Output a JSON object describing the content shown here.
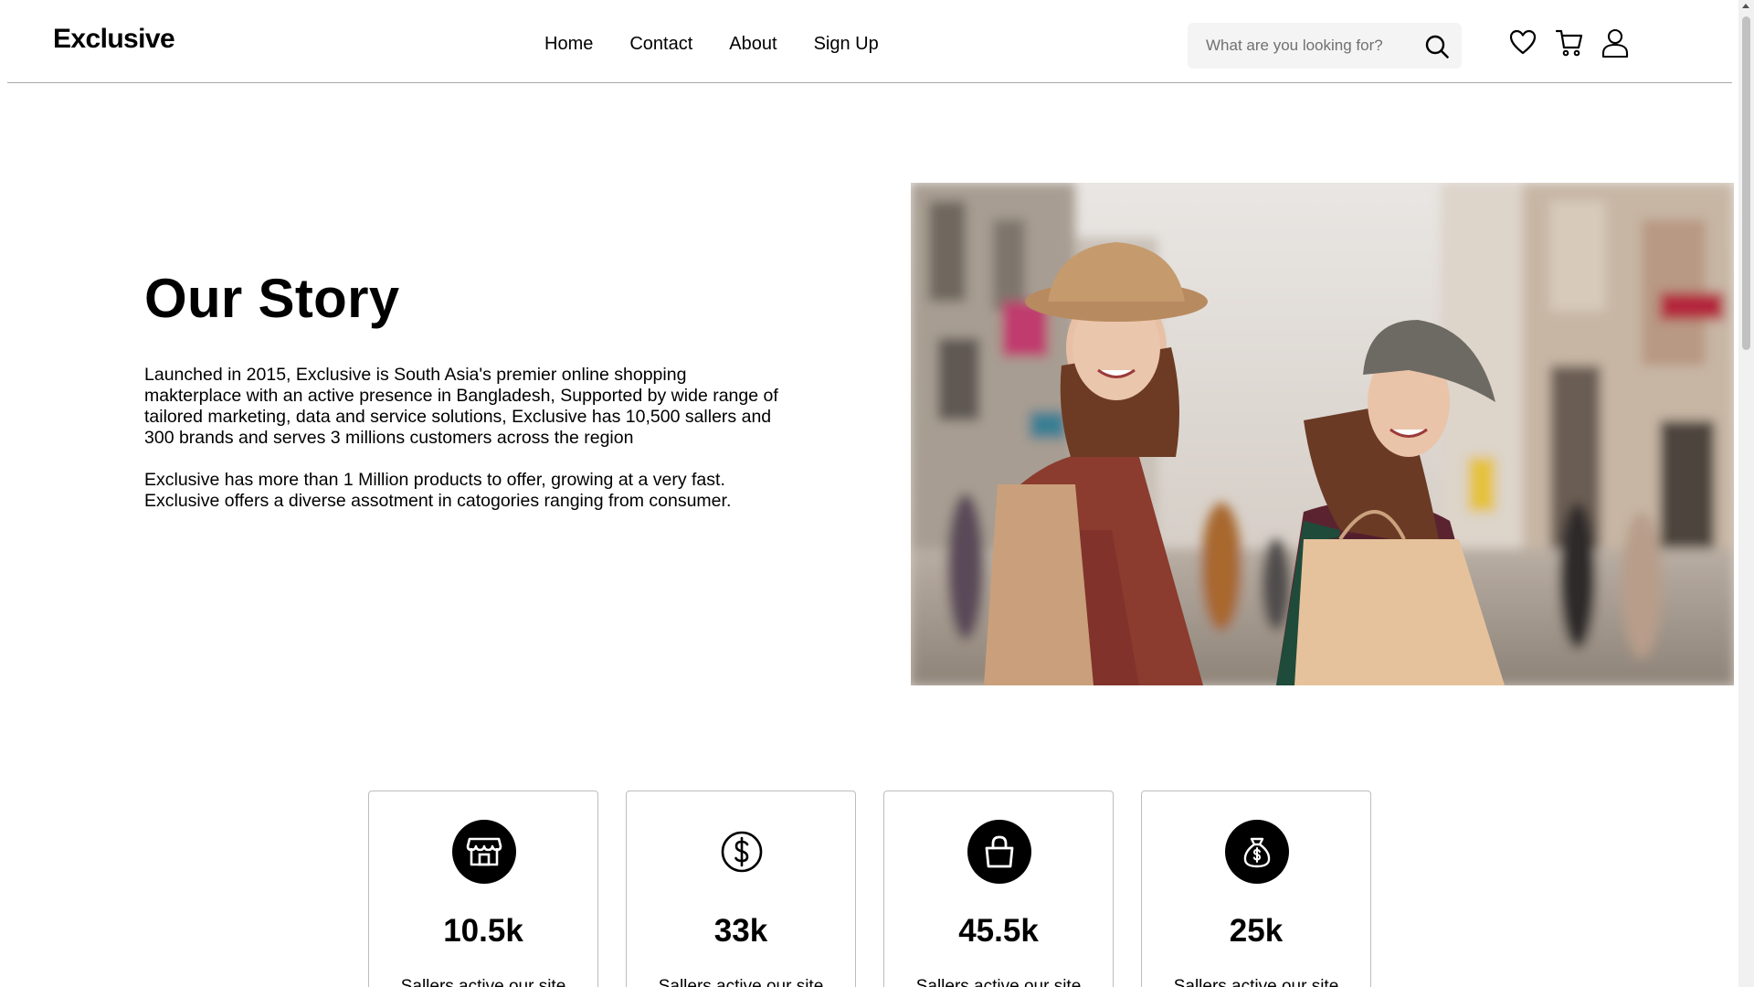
{
  "header": {
    "logo": "Exclusive",
    "nav": [
      {
        "label": "Home"
      },
      {
        "label": "Contact"
      },
      {
        "label": "About"
      },
      {
        "label": "Sign Up"
      }
    ],
    "search": {
      "placeholder": "What are you looking for?",
      "value": "",
      "icon": "search-icon"
    },
    "icons": [
      "heart-icon",
      "cart-icon",
      "user-icon"
    ]
  },
  "story": {
    "title": "Our Story",
    "paragraph1": "Launched in 2015, Exclusive is South Asia's premier online shopping makterplace with an active presence in Bangladesh, Supported by wide range of tailored marketing, data and service solutions, Exclusive has 10,500 sallers and 300 brands and serves 3 millions customers across the region",
    "paragraph2": "Exclusive has more than 1 Million products to offer, growing at a very fast. Exclusive offers a diverse assotment in catogories ranging from consumer.",
    "image": "two-women-shopping-photo"
  },
  "stats": [
    {
      "icon": "shop-icon",
      "value": "10.5k",
      "label": "Sallers active our site"
    },
    {
      "icon": "dollar-icon",
      "value": "33k",
      "label": "Sallers active our site"
    },
    {
      "icon": "shopping-bag-icon",
      "value": "45.5k",
      "label": "Sallers active our site"
    },
    {
      "icon": "money-bag-icon",
      "value": "25k",
      "label": "Sallers active our site"
    }
  ],
  "colors": {
    "text": "#000000",
    "search_bg": "#f4f4f4",
    "divider": "#a9a9a9",
    "card_border": "#bdbdbd"
  }
}
